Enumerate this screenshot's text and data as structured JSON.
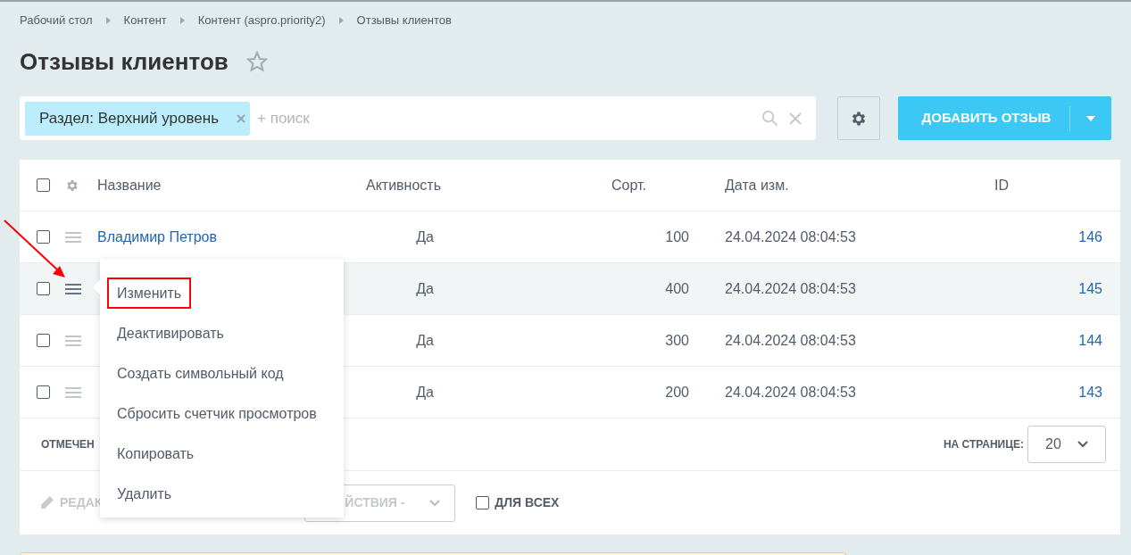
{
  "breadcrumbs": [
    "Рабочий стол",
    "Контент",
    "Контент (aspro.priority2)",
    "Отзывы клиентов"
  ],
  "title": "Отзывы клиентов",
  "favorite": false,
  "filter": {
    "tag": "Раздел: Верхний уровень",
    "placeholder": "+ поиск"
  },
  "add_button": {
    "label": "ДОБАВИТЬ ОТЗЫВ"
  },
  "table": {
    "all_checked": false,
    "columns": [
      "Название",
      "Активность",
      "Сорт.",
      "Дата изм.",
      "ID"
    ],
    "rows": [
      {
        "name": "Владимир Петров",
        "active": "Да",
        "sort": "100",
        "modified": "24.04.2024 08:04:53",
        "id": "146",
        "checked": false,
        "highlighted": false
      },
      {
        "active": "Да",
        "sort": "400",
        "modified": "24.04.2024 08:04:53",
        "id": "145",
        "checked": false,
        "highlighted": true
      },
      {
        "active": "Да",
        "sort": "300",
        "modified": "24.04.2024 08:04:53",
        "id": "144",
        "checked": false,
        "highlighted": false
      },
      {
        "active": "Да",
        "sort": "200",
        "modified": "24.04.2024 08:04:53",
        "id": "143",
        "checked": false,
        "highlighted": false
      }
    ]
  },
  "context_menu": {
    "items": [
      {
        "label": "Изменить",
        "highlighted": true
      },
      {
        "label": "Деактивировать",
        "highlighted": false
      },
      {
        "label": "Создать символьный код",
        "highlighted": false
      },
      {
        "label": "Сбросить счетчик просмотров",
        "highlighted": false
      },
      {
        "label": "Копировать",
        "highlighted": false
      },
      {
        "label": "Удалить",
        "highlighted": false
      }
    ]
  },
  "footer": {
    "selected_label": "ОТМЕЧЕН",
    "per_page_label": "НА СТРАНИЦЕ:",
    "per_page": "20",
    "edit_label": "РЕДАК",
    "actions_label": "ЙСТВИЯ -",
    "for_all_label": "ДЛЯ ВСЕХ",
    "for_all": false
  }
}
